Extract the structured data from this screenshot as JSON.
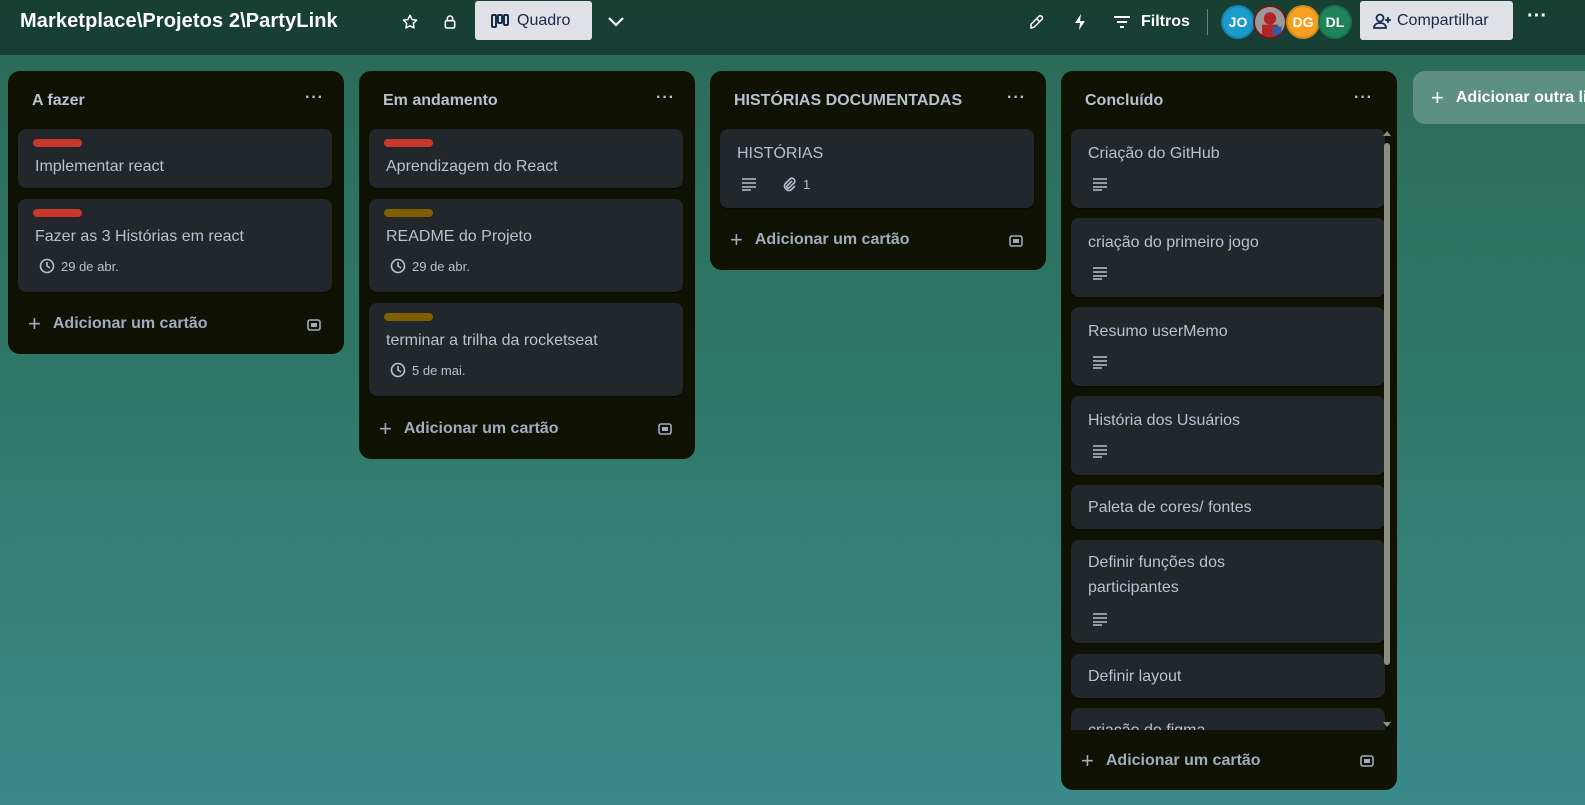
{
  "header": {
    "board_title": "Marketplace\\Projetos 2\\PartyLink",
    "view_label": "Quadro",
    "filter_label": "Filtros",
    "share_label": "Compartilhar",
    "more": "···",
    "avatars": [
      {
        "initials": "JO",
        "color": "#1b9bcc"
      },
      {
        "initials": "",
        "color": "#7a2020"
      },
      {
        "initials": "DG",
        "color": "#f5a020"
      },
      {
        "initials": "DL",
        "color": "#1f845a"
      }
    ]
  },
  "colors": {
    "label_red": "#c9372c",
    "label_yellow": "#7f5f01"
  },
  "lists": [
    {
      "title": "A fazer",
      "menu": "···",
      "add_card": "Adicionar um cartão",
      "cards": [
        {
          "title": "Implementar react",
          "label": "red"
        },
        {
          "title": "Fazer as 3 Histórias em react",
          "label": "red",
          "due": "29 de abr."
        }
      ]
    },
    {
      "title": "Em andamento",
      "menu": "···",
      "add_card": "Adicionar um cartão",
      "cards": [
        {
          "title": "Aprendizagem do React",
          "label": "red"
        },
        {
          "title": "README do Projeto",
          "label": "yellow",
          "due": "29 de abr."
        },
        {
          "title": "terminar a trilha da rocketseat",
          "label": "yellow",
          "due": "5 de mai."
        }
      ]
    },
    {
      "title": "HISTÓRIAS DOCUMENTADAS",
      "menu": "···",
      "add_card": "Adicionar um cartão",
      "cards": [
        {
          "title": "HISTÓRIAS",
          "attachments": "1"
        }
      ]
    },
    {
      "title": "Concluído",
      "menu": "···",
      "add_card": "Adicionar um cartão",
      "cards": [
        {
          "title": "Criação do GitHub"
        },
        {
          "title": "criação do primeiro jogo"
        },
        {
          "title": "Resumo userMemo"
        },
        {
          "title": "História dos Usuários"
        },
        {
          "title": "Paleta de cores/ fontes"
        },
        {
          "title_line1": "Definir funções dos",
          "title_line2": "participantes"
        },
        {
          "title": "Definir layout"
        },
        {
          "title": "criação do figma"
        }
      ]
    }
  ],
  "add_list": "Adicionar outra lista"
}
